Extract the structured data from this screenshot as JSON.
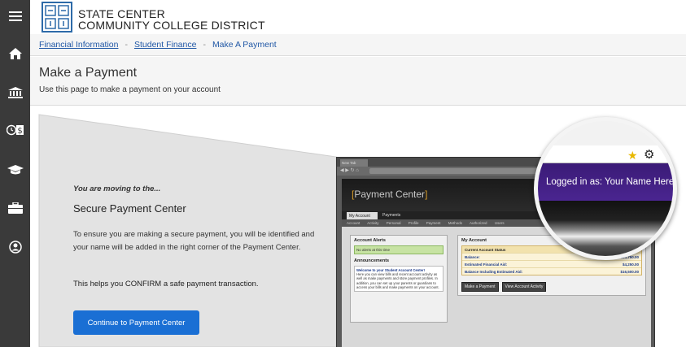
{
  "sidebar": {
    "items": [
      {
        "icon": "menu-icon"
      },
      {
        "icon": "home-icon"
      },
      {
        "icon": "bank-icon"
      },
      {
        "icon": "payment-icon"
      },
      {
        "icon": "graduation-cap-icon"
      },
      {
        "icon": "briefcase-icon"
      },
      {
        "icon": "user-icon"
      }
    ]
  },
  "header": {
    "logo_line1": "STATE CENTER",
    "logo_line2": "COMMUNITY COLLEGE DISTRICT"
  },
  "breadcrumb": {
    "items": [
      "Financial Information",
      "Student Finance",
      "Make A Payment"
    ],
    "separator": "-"
  },
  "page": {
    "title": "Make a Payment",
    "subtitle": "Use this page to make a payment on your account"
  },
  "message": {
    "moving": "You are moving to the...",
    "title": "Secure Payment Center",
    "body": "To ensure you are making a secure payment, you will be identified and your name will be added in the right corner of the Payment Center.",
    "confirm": "This helps you CONFIRM a safe payment transaction.",
    "button": "Continue to Payment Center"
  },
  "mockup": {
    "tab": "New Tab",
    "header_title": "Payment Center",
    "tabs": [
      "My Account",
      "Payments"
    ],
    "subtabs": "Account Activity  Personal Profile  Payment Methods  Authorized Users",
    "alerts_title": "Account Alerts",
    "alerts_text": "No alerts at this time",
    "announcements_title": "Announcements",
    "announcement_head": "Welcome to your Student Account Center!",
    "announcement_body": "Here you can view bills and recent account activity as well as make payments and store payment profiles. In addition, you can set up your parents or guardians to access your bills and make payments on your account.",
    "my_account": "My Account",
    "status_title": "Current Account Status",
    "rows": [
      {
        "label": "Balance:",
        "value": "$20,750.00"
      },
      {
        "label": "Estimated Financial Aid:",
        "value": "$4,250.00"
      },
      {
        "label": "Balance Including Estimated Aid:",
        "value": "$16,500.00"
      }
    ],
    "btn_make": "Make a Payment",
    "btn_view": "View Account Activity",
    "logged_in": "Logged in as: Your Name Here"
  },
  "colors": {
    "sidebar": "#3a3a3a",
    "link": "#2158a6",
    "button": "#1a6fd4",
    "purple": "#3b1b77"
  }
}
